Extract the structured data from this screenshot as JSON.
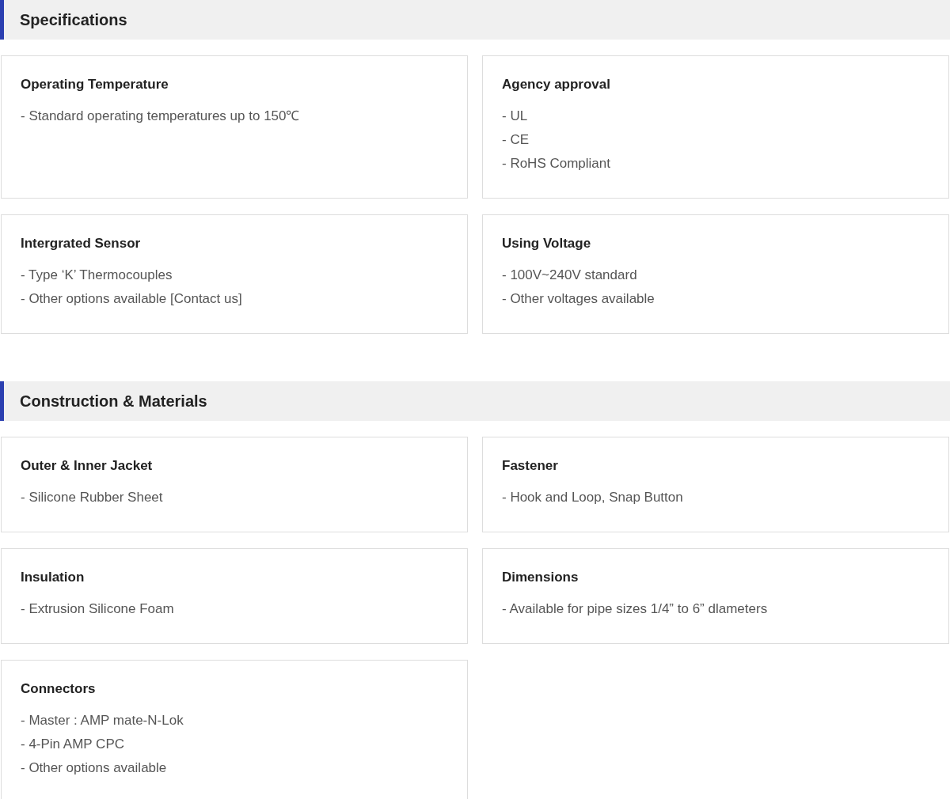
{
  "sections": [
    {
      "title": "Specifications",
      "cards": [
        {
          "title": "Operating Temperature",
          "items": [
            "- Standard operating temperatures up to 150℃"
          ]
        },
        {
          "title": "Agency approval",
          "items": [
            "- UL",
            "- CE",
            "- RoHS Compliant"
          ]
        },
        {
          "title": "Intergrated Sensor",
          "items": [
            "- Type ‘K’ Thermocouples",
            "- Other options available [Contact us]"
          ]
        },
        {
          "title": "Using Voltage",
          "items": [
            "- 100V~240V standard",
            "- Other voltages available"
          ]
        }
      ]
    },
    {
      "title": "Construction & Materials",
      "cards": [
        {
          "title": "Outer & Inner Jacket",
          "items": [
            "- Silicone Rubber Sheet"
          ]
        },
        {
          "title": "Fastener",
          "items": [
            "- Hook and Loop, Snap Button"
          ]
        },
        {
          "title": "Insulation",
          "items": [
            "- Extrusion Silicone Foam"
          ]
        },
        {
          "title": "Dimensions",
          "items": [
            "- Available for pipe sizes 1/4” to 6” dlameters"
          ]
        },
        {
          "title": "Connectors",
          "items": [
            "- Master : AMP mate-N-Lok",
            "- 4-Pin AMP CPC",
            "- Other options available"
          ]
        }
      ]
    }
  ]
}
